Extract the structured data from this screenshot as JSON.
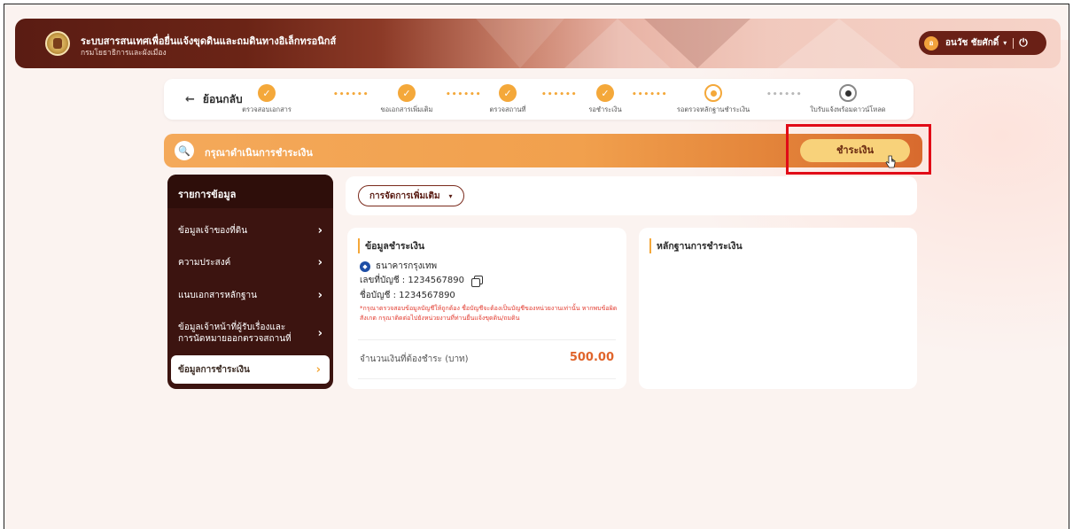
{
  "header": {
    "system_title": "ระบบสารสนเทศเพื่อยื่นแจ้งขุดดินและถมดินทางอิเล็กทรอนิกส์",
    "department": "กรมโยธาธิการและผังเมือง",
    "user": {
      "avatar_initial": "อ",
      "name": "อนวัช ชัยศักดิ์",
      "caret": "▾",
      "power": "⏻"
    }
  },
  "stepper": {
    "back_label": "ย้อนกลับ",
    "steps": [
      {
        "label": "ตรวจสอบเอกสาร",
        "state": "done"
      },
      {
        "label": "ขอเอกสารเพิ่มเติม",
        "state": "done"
      },
      {
        "label": "ตรวจสถานที่",
        "state": "done"
      },
      {
        "label": "รอชำระเงิน",
        "state": "done"
      },
      {
        "label": "รอตรวจหลักฐานชำระเงิน",
        "state": "current"
      },
      {
        "label": "ใบรับแจ้งพร้อมดาวน์โหลด",
        "state": "pending"
      }
    ],
    "connector": "••••••"
  },
  "banner": {
    "text": "กรุณาดำเนินการชำระเงิน",
    "pay_button": "ชำระเงิน"
  },
  "sidebar": {
    "title": "รายการข้อมูล",
    "items": [
      {
        "label": "ข้อมูลเจ้าของที่ดิน"
      },
      {
        "label": "ความประสงค์"
      },
      {
        "label": "แนบเอกสารหลักฐาน"
      },
      {
        "label": "ข้อมูลเจ้าหน้าที่ผู้รับเรื่องและ",
        "label2": "การนัดหมายออกตรวจสถานที่"
      },
      {
        "label": "ข้อมูลการชำระเงิน",
        "active": true
      }
    ]
  },
  "manage": {
    "button_label": "การจัดการเพิ่มเติม",
    "caret": "▾"
  },
  "payment_card": {
    "title": "ข้อมูลชำระเงิน",
    "bank_name": "ธนาคารกรุงเทพ",
    "account_no": "เลขที่บัญชี : 1234567890",
    "account_name": "ชื่อบัญชี : 1234567890",
    "warning": "*กรุณาตรวจสอบข้อมูลบัญชีให้ถูกต้อง ชื่อบัญชีจะต้องเป็นบัญชีของหน่วยงานเท่านั้น หากพบข้อผิดสังเกต กรุณาติดต่อไปยังหน่วยงานที่ท่านยื่นแจ้งขุดดิน/ถมดิน",
    "amount_label": "จำนวนเงินที่ต้องชำระ (บาท)",
    "amount_value": "500.00"
  },
  "proof_card": {
    "title": "หลักฐานการชำระเงิน"
  },
  "colors": {
    "accent": "#f4a83a",
    "header_dark": "#5a1c13",
    "amount": "#e0642b",
    "highlight": "#e10b17"
  }
}
